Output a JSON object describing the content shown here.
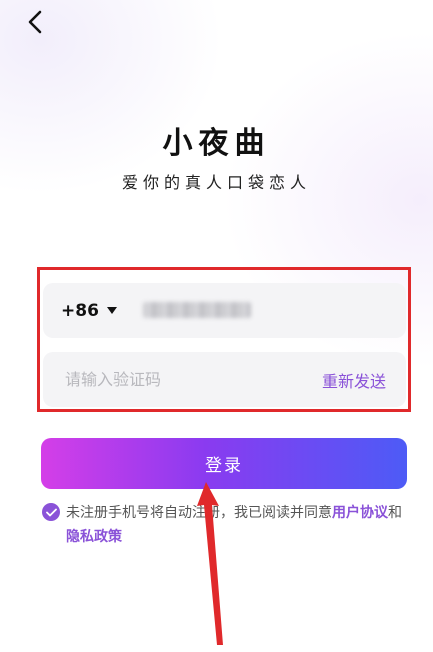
{
  "header": {
    "back_icon": "chevron-left-icon"
  },
  "brand": {
    "title": "小夜曲",
    "slogan": "爱你的真人口袋恋人"
  },
  "phone": {
    "country_code": "+86",
    "dropdown_icon": "caret-down-icon"
  },
  "code": {
    "placeholder": "请输入验证码",
    "resend_label": "重新发送"
  },
  "login": {
    "label": "登录"
  },
  "agreement": {
    "check_icon": "check-icon",
    "text_prefix": "未注册手机号将自动注册，我已阅读并同意",
    "user_agreement": "用户协议",
    "and_text": "和",
    "privacy_policy": "隐私政策"
  },
  "colors": {
    "accent": "#8a52d8",
    "gradient_start": "#d43ee8",
    "gradient_end": "#4d5bf6",
    "highlight": "#e0292b",
    "input_bg": "#f4f4f6"
  }
}
